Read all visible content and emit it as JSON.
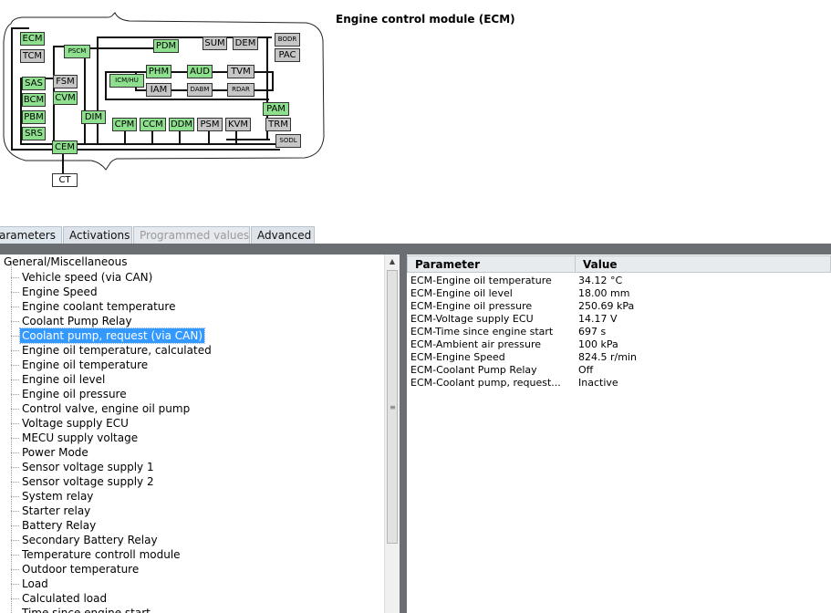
{
  "diagram": {
    "title": "Engine control module (ECM)",
    "modules": {
      "ecm": "ECM",
      "tcm": "TCM",
      "pscm": "PSCM",
      "pdm": "PDM",
      "sum": "SUM",
      "dem": "DEM",
      "bodr": "BODR",
      "pac": "PAC",
      "sas": "SAS",
      "fsm": "FSM",
      "bcm": "BCM",
      "cvm": "CVM",
      "icmhu": "ICM/HU",
      "phm": "PHM",
      "aud": "AUD",
      "tvm": "TVM",
      "iam": "IAM",
      "dabm": "DABM",
      "rdar": "RDAR",
      "pbm": "PBM",
      "srs": "SRS",
      "dim": "DIM",
      "cpm": "CPM",
      "ccm": "CCM",
      "ddm": "DDM",
      "psm": "PSM",
      "kvm": "KVM",
      "pam": "PAM",
      "trm": "TRM",
      "sodl": "SODL",
      "cem": "CEM",
      "ct": "CT"
    },
    "colors": {
      "active": "#8ee08e",
      "inactive": "#c6c6c6"
    }
  },
  "tabs": [
    "arameters",
    "Activations",
    "Programmed values",
    "Advanced"
  ],
  "tree": {
    "root": "General/Miscellaneous",
    "items": [
      "Vehicle speed (via CAN)",
      "Engine Speed",
      "Engine coolant temperature",
      "Coolant Pump Relay",
      "Coolant pump, request (via CAN)",
      "Engine oil temperature, calculated",
      "Engine oil temperature",
      "Engine oil level",
      "Engine oil pressure",
      "Control valve, engine oil pump",
      "Voltage supply ECU",
      "MECU supply voltage",
      "Power Mode",
      "Sensor voltage supply 1",
      "Sensor voltage supply 2",
      "System relay",
      "Starter relay",
      "Battery Relay",
      "Secondary Battery Relay",
      "Temperature controll module",
      "Outdoor temperature",
      "Load",
      "Calculated load",
      "Time since engine start"
    ],
    "selected_index": 4
  },
  "table": {
    "headers": {
      "parameter": "Parameter",
      "value": "Value"
    },
    "rows": [
      {
        "parameter": "ECM-Engine oil temperature",
        "value": "34.12 °C"
      },
      {
        "parameter": "ECM-Engine oil level",
        "value": "18.00 mm"
      },
      {
        "parameter": "ECM-Engine oil pressure",
        "value": "250.69 kPa"
      },
      {
        "parameter": "ECM-Voltage supply ECU",
        "value": "14.17 V"
      },
      {
        "parameter": "ECM-Time since engine start",
        "value": "697 s"
      },
      {
        "parameter": "ECM-Ambient air pressure",
        "value": "100 kPa"
      },
      {
        "parameter": "ECM-Engine Speed",
        "value": "824.5 r/min"
      },
      {
        "parameter": "ECM-Coolant Pump Relay",
        "value": "Off"
      },
      {
        "parameter": "ECM-Coolant pump, request...",
        "value": "Inactive"
      }
    ]
  },
  "scrollbar": {
    "up_arrow": "▲",
    "grip": "≡"
  }
}
